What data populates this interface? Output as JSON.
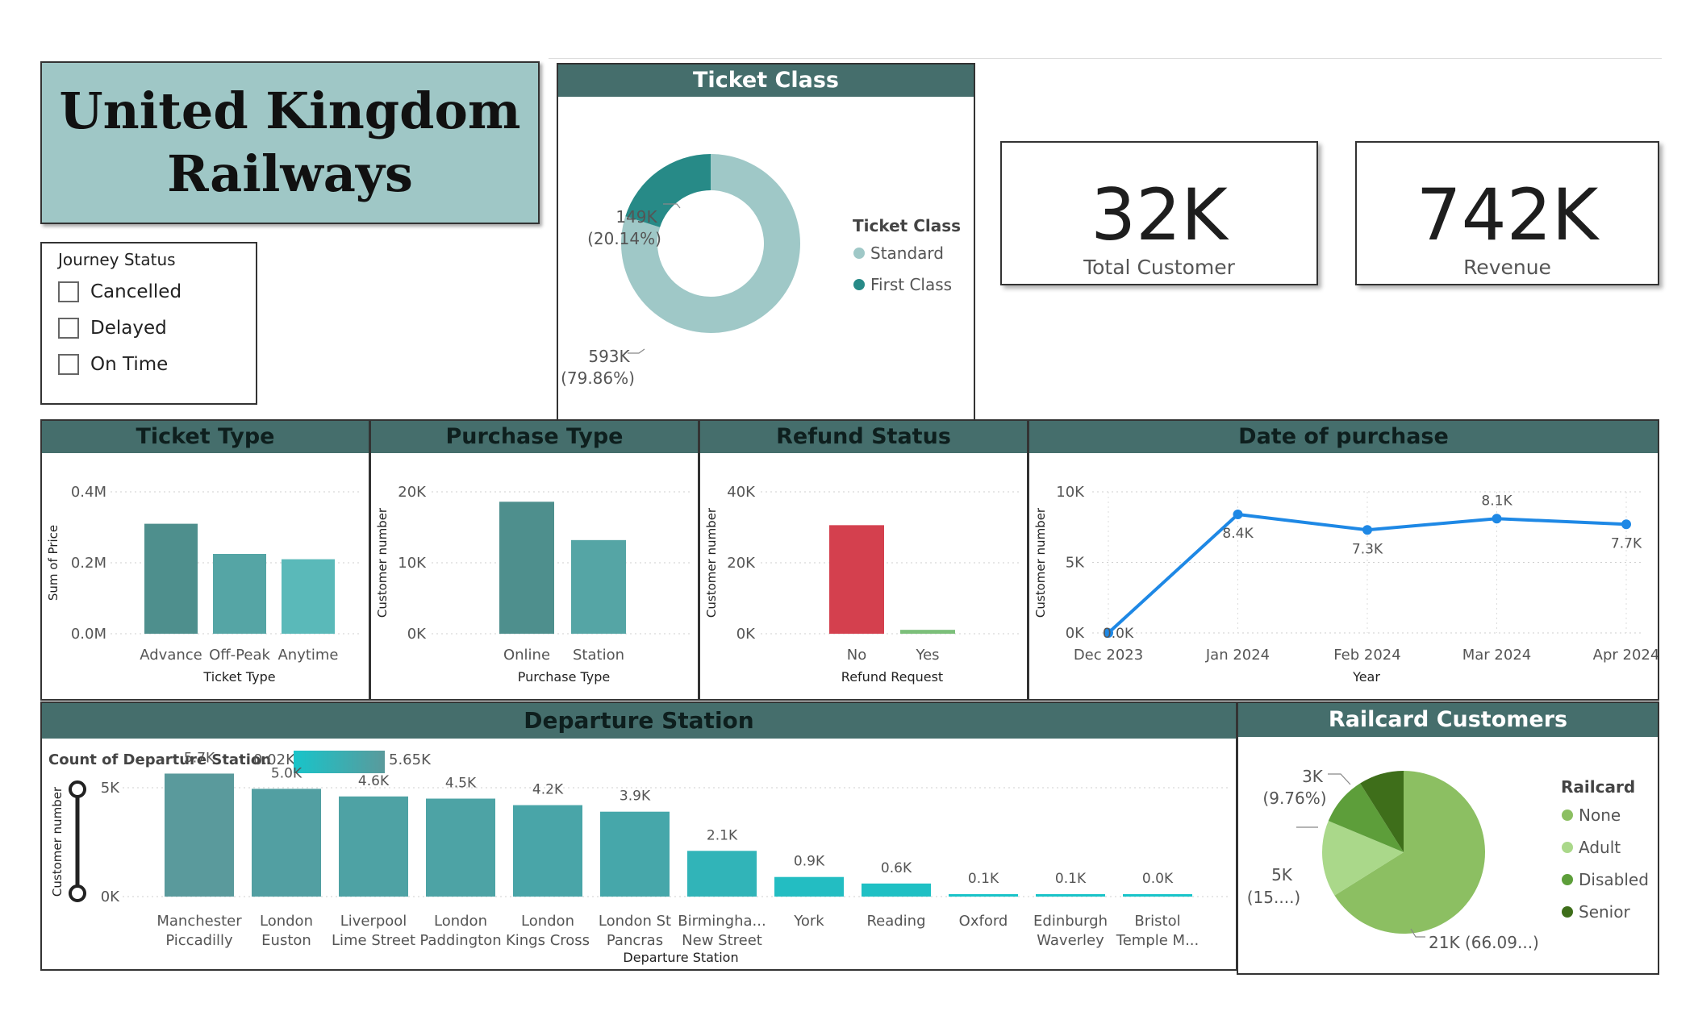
{
  "title": "United Kingdom\nRailways",
  "journey_status": {
    "header": "Journey Status",
    "options": [
      "Cancelled",
      "Delayed",
      "On Time"
    ]
  },
  "kpis": [
    {
      "value": "32K",
      "label": "Total Customer"
    },
    {
      "value": "742K",
      "label": "Revenue"
    }
  ],
  "colors": {
    "header_bg": "#456e6c",
    "teal_dark": "#4e8f8d",
    "teal_mid": "#55a5a5",
    "teal_light": "#5ab9b9",
    "refund_no": "#d4404e",
    "refund_yes": "#7cbf7a",
    "line": "#1e88e5",
    "ticket_standard": "#9fc8c7",
    "ticket_first": "#278a87",
    "rail_none": "#8cbf62",
    "rail_adult": "#aad88a",
    "rail_disabled": "#5d9e3a",
    "rail_senior": "#3e6e1a"
  },
  "chart_data": [
    {
      "id": "ticket_class",
      "type": "pie",
      "title": "Ticket Class",
      "legend_title": "Ticket Class",
      "slices": [
        {
          "name": "Standard",
          "value": 593,
          "label": "593K",
          "pct": "(79.86%)"
        },
        {
          "name": "First Class",
          "value": 149,
          "label": "149K",
          "pct": "(20.14%)"
        }
      ]
    },
    {
      "id": "ticket_type",
      "type": "bar",
      "title": "Ticket Type",
      "xlabel": "Ticket Type",
      "ylabel": "Sum of Price",
      "categories": [
        "Advance",
        "Off-Peak",
        "Anytime"
      ],
      "values": [
        0.31,
        0.225,
        0.21
      ],
      "yticks": [
        0,
        0.2,
        0.4
      ],
      "ytick_labels": [
        "0.0M",
        "0.2M",
        "0.4M"
      ],
      "ylim": [
        0,
        0.4
      ]
    },
    {
      "id": "purchase_type",
      "type": "bar",
      "title": "Purchase Type",
      "xlabel": "Purchase Type",
      "ylabel": "Customer number",
      "categories": [
        "Online",
        "Station"
      ],
      "values": [
        18600,
        13200
      ],
      "yticks": [
        0,
        10000,
        20000
      ],
      "ytick_labels": [
        "0K",
        "10K",
        "20K"
      ],
      "ylim": [
        0,
        20000
      ]
    },
    {
      "id": "refund_status",
      "type": "bar",
      "title": "Refund Status",
      "xlabel": "Refund Request",
      "ylabel": "Customer number",
      "categories": [
        "No",
        "Yes"
      ],
      "values": [
        30600,
        1100
      ],
      "yticks": [
        0,
        20000,
        40000
      ],
      "ytick_labels": [
        "0K",
        "20K",
        "40K"
      ],
      "ylim": [
        0,
        40000
      ]
    },
    {
      "id": "date_of_purchase",
      "type": "line",
      "title": "Date of purchase",
      "xlabel": "Year",
      "ylabel": "Customer number",
      "categories": [
        "Dec 2023",
        "Jan 2024",
        "Feb 2024",
        "Mar 2024",
        "Apr 2024"
      ],
      "values": [
        0,
        8400,
        7300,
        8100,
        7700
      ],
      "labels": [
        "0.0K",
        "8.4K",
        "7.3K",
        "8.1K",
        "7.7K"
      ],
      "yticks": [
        0,
        5000,
        10000
      ],
      "ytick_labels": [
        "0K",
        "5K",
        "10K"
      ],
      "ylim": [
        0,
        10000
      ]
    },
    {
      "id": "departure_station",
      "type": "bar",
      "title": "Departure Station",
      "xlabel": "Departure Station",
      "ylabel": "Customer number",
      "color_legend": {
        "title": "Count of Departure Station",
        "min": "0.02K",
        "max": "5.65K"
      },
      "categories": [
        [
          "Manchester",
          "Piccadilly"
        ],
        [
          "London",
          "Euston"
        ],
        [
          "Liverpool",
          "Lime Street"
        ],
        [
          "London",
          "Paddington"
        ],
        [
          "London",
          "Kings Cross"
        ],
        [
          "London St",
          "Pancras"
        ],
        [
          "Birmingha...",
          "New Street"
        ],
        [
          "York"
        ],
        [
          "Reading"
        ],
        [
          "Oxford"
        ],
        [
          "Edinburgh",
          "Waverley"
        ],
        [
          "Bristol",
          "Temple M..."
        ]
      ],
      "values": [
        5650,
        4950,
        4600,
        4500,
        4200,
        3900,
        2100,
        900,
        600,
        100,
        80,
        30
      ],
      "labels": [
        "5.7K",
        "5.0K",
        "4.6K",
        "4.5K",
        "4.2K",
        "3.9K",
        "2.1K",
        "0.9K",
        "0.6K",
        "0.1K",
        "0.1K",
        "0.0K"
      ],
      "yticks": [
        0,
        5000
      ],
      "ytick_labels": [
        "0K",
        "5K"
      ],
      "ylim": [
        0,
        6000
      ]
    },
    {
      "id": "railcard_customers",
      "type": "pie",
      "title": "Railcard Customers",
      "legend_title": "Railcard",
      "slices": [
        {
          "name": "None",
          "value": 66.09,
          "label": "21K (66.09...)"
        },
        {
          "name": "Adult",
          "value": 15.2,
          "label": "5K",
          "pct": "(15....)"
        },
        {
          "name": "Disabled",
          "value": 9.76,
          "label": "3K",
          "pct": "(9.76%)"
        },
        {
          "name": "Senior",
          "value": 8.95
        }
      ]
    }
  ]
}
